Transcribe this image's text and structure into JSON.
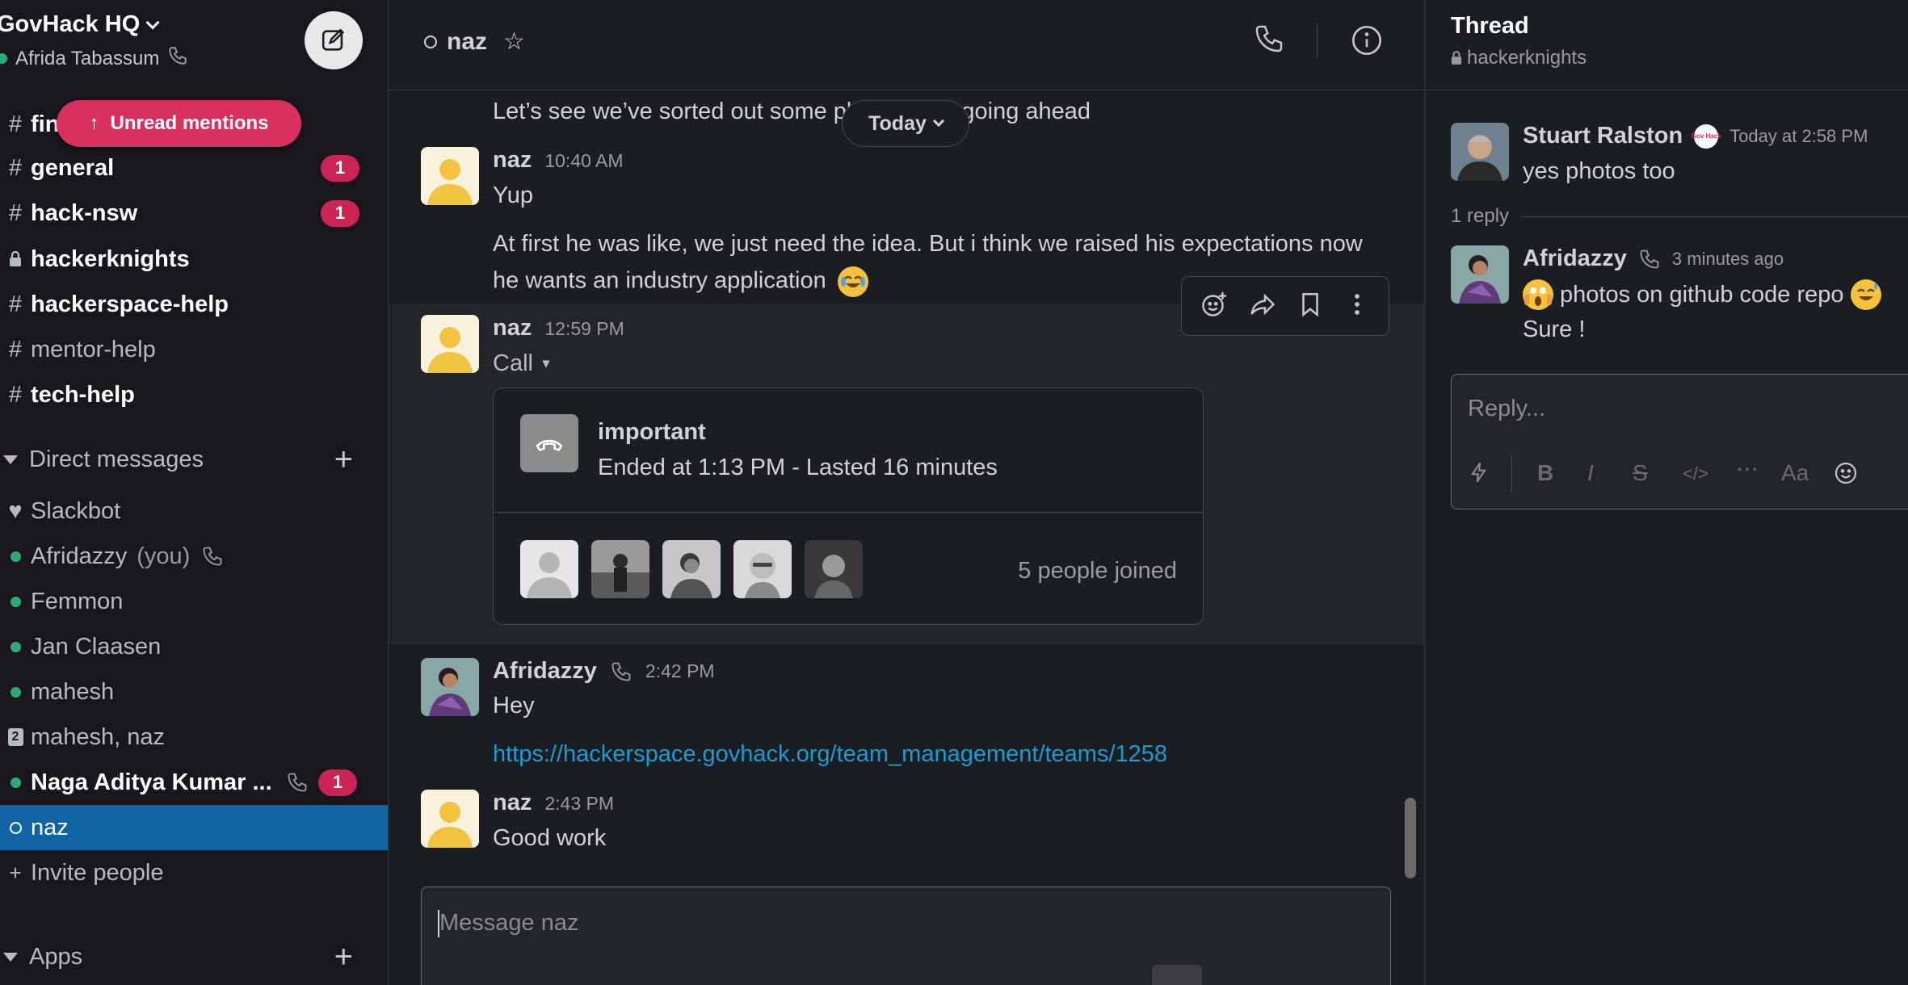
{
  "workspace": {
    "name": "GovHack HQ",
    "user": "Afrida Tabassum",
    "unread_mentions_label": "Unread mentions"
  },
  "channels": [
    {
      "name": "fin",
      "bold": true,
      "badge": ""
    },
    {
      "name": "general",
      "bold": true,
      "badge": "1"
    },
    {
      "name": "hack-nsw",
      "bold": true,
      "badge": "1"
    },
    {
      "name": "hackerknights",
      "bold": true,
      "badge": "",
      "private": true
    },
    {
      "name": "hackerspace-help",
      "bold": true,
      "badge": ""
    },
    {
      "name": "mentor-help",
      "bold": false,
      "badge": ""
    },
    {
      "name": "tech-help",
      "bold": true,
      "badge": ""
    }
  ],
  "direct_messages": {
    "header": "Direct messages",
    "items": [
      {
        "name": "Slackbot"
      },
      {
        "name": "Afridazzy",
        "suffix": "(you)"
      },
      {
        "name": "Femmon"
      },
      {
        "name": "Jan Claasen"
      },
      {
        "name": "mahesh"
      },
      {
        "name": "mahesh, naz",
        "group_count": "2"
      },
      {
        "name": "Naga Aditya Kumar ...",
        "badge": "1"
      },
      {
        "name": "naz"
      }
    ],
    "invite_label": "Invite people"
  },
  "apps_header": "Apps",
  "conversation": {
    "title": "naz",
    "today_label": "Today",
    "messages": [
      {
        "text": "Let’s see we’ve sorted out some pl",
        "text_tail": "going ahead"
      },
      {
        "author": "naz",
        "time": "10:40 AM",
        "lines": [
          "Yup",
          "At first he was like, we just need the idea. But i think we raised his expectations now",
          "he wants an industry application"
        ]
      },
      {
        "author": "naz",
        "time": "12:59 PM",
        "text": "Call"
      },
      {
        "author": "Afridazzy",
        "time": "2:42 PM",
        "text": "Hey",
        "link": "https://hackerspace.govhack.org/team_management/teams/1258"
      },
      {
        "author": "naz",
        "time": "2:43 PM",
        "text": "Good work"
      }
    ],
    "call": {
      "title": "important",
      "subtitle": "Ended at 1:13 PM - Lasted 16 minutes",
      "joined": "5 people joined"
    },
    "composer_placeholder": "Message naz"
  },
  "thread": {
    "title": "Thread",
    "channel": "hackerknights",
    "parent": {
      "author": "Stuart Ralston",
      "time": "Today at 2:58 PM",
      "text": "yes photos too",
      "badge_text": "Gov Hack"
    },
    "reply_count": "1 reply",
    "reply": {
      "author": "Afridazzy",
      "time": "3 minutes ago",
      "line1": "photos on github code repo",
      "line2": "Sure !"
    },
    "composer_placeholder": "Reply..."
  },
  "colors": {
    "sidebar_bg": "#19171d",
    "main_bg": "#1a1d21",
    "selected": "#1164a3",
    "badge": "#cd2553",
    "mention_pill": "#d9305e",
    "presence": "#2bac76",
    "link": "#1d9bd1"
  },
  "icons": [
    "chevron-down-icon",
    "phone-icon",
    "compose-icon",
    "hash-icon",
    "lock-icon",
    "plus-icon",
    "heart-icon",
    "star-icon",
    "info-icon",
    "add-reaction-icon",
    "share-icon",
    "bookmark-icon",
    "more-icon",
    "hangup-icon",
    "shortcuts-icon",
    "bold-icon",
    "italic-icon",
    "strike-icon",
    "code-icon",
    "formatting-icon",
    "emoji-icon"
  ]
}
